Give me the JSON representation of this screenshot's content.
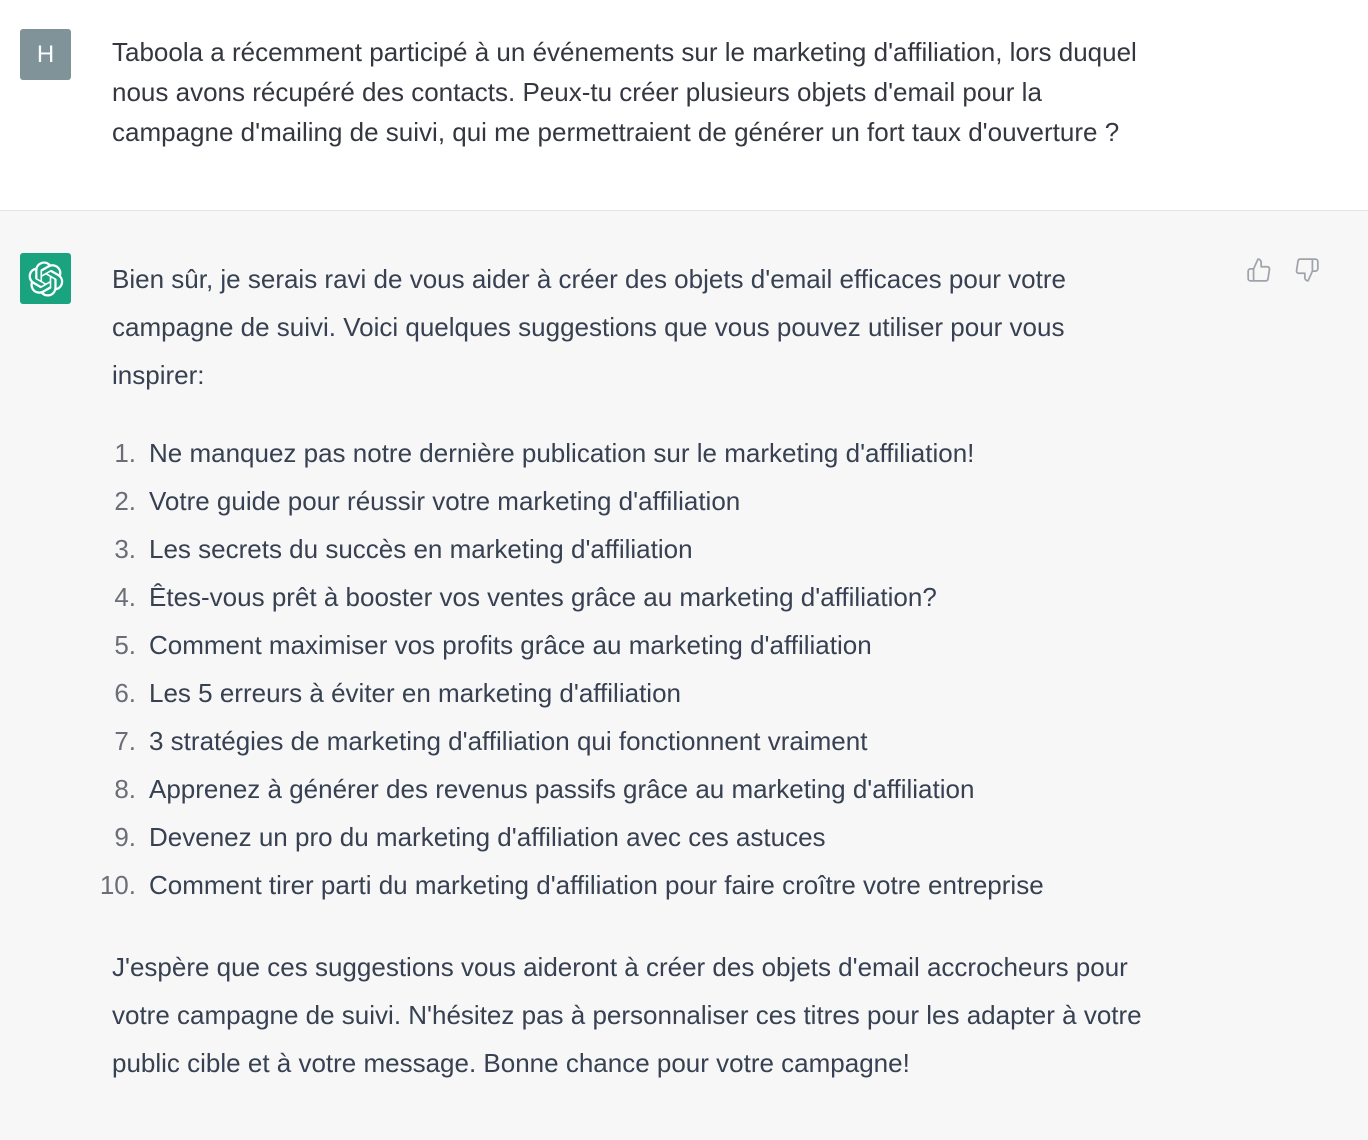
{
  "user_message": {
    "avatar_letter": "H",
    "text": "Taboola a récemment participé à un événements sur le marketing d'affiliation, lors duquel\nnous avons récupéré des contacts. Peux-tu créer plusieurs objets d'email pour la\ncampagne d'mailing de suivi, qui me permettraient de générer un fort taux d'ouverture ?"
  },
  "assistant_message": {
    "avatar_icon": "openai-logo-icon",
    "intro": "Bien sûr, je serais ravi de vous aider à créer des objets d'email efficaces pour votre\ncampagne de suivi. Voici quelques suggestions que vous pouvez utiliser pour vous\ninspirer:",
    "list": [
      {
        "num": "1.",
        "text": "Ne manquez pas notre dernière publication sur le marketing d'affiliation!"
      },
      {
        "num": "2.",
        "text": "Votre guide pour réussir votre marketing d'affiliation"
      },
      {
        "num": "3.",
        "text": "Les secrets du succès en marketing d'affiliation"
      },
      {
        "num": "4.",
        "text": "Êtes-vous prêt à booster vos ventes grâce au marketing d'affiliation?"
      },
      {
        "num": "5.",
        "text": "Comment maximiser vos profits grâce au marketing d'affiliation"
      },
      {
        "num": "6.",
        "text": "Les 5 erreurs à éviter en marketing d'affiliation"
      },
      {
        "num": "7.",
        "text": "3 stratégies de marketing d'affiliation qui fonctionnent vraiment"
      },
      {
        "num": "8.",
        "text": "Apprenez à générer des revenus passifs grâce au marketing d'affiliation"
      },
      {
        "num": "9.",
        "text": "Devenez un pro du marketing d'affiliation avec ces astuces"
      },
      {
        "num": "10.",
        "text": "Comment tirer parti du marketing d'affiliation pour faire croître votre entreprise"
      }
    ],
    "outro": "J'espère que ces suggestions vous aideront à créer des objets d'email accrocheurs pour\nvotre campagne de suivi. N'hésitez pas à personnaliser ces titres pour les adapter à votre\npublic cible et à votre message. Bonne chance pour votre campagne!",
    "feedback": {
      "up_icon": "thumbs-up-icon",
      "down_icon": "thumbs-down-icon"
    }
  },
  "colors": {
    "user_bg": "#ffffff",
    "assistant_bg": "#f7f7f8",
    "user_avatar": "#7f9399",
    "bot_avatar": "#19a37f",
    "text": "#374151"
  }
}
